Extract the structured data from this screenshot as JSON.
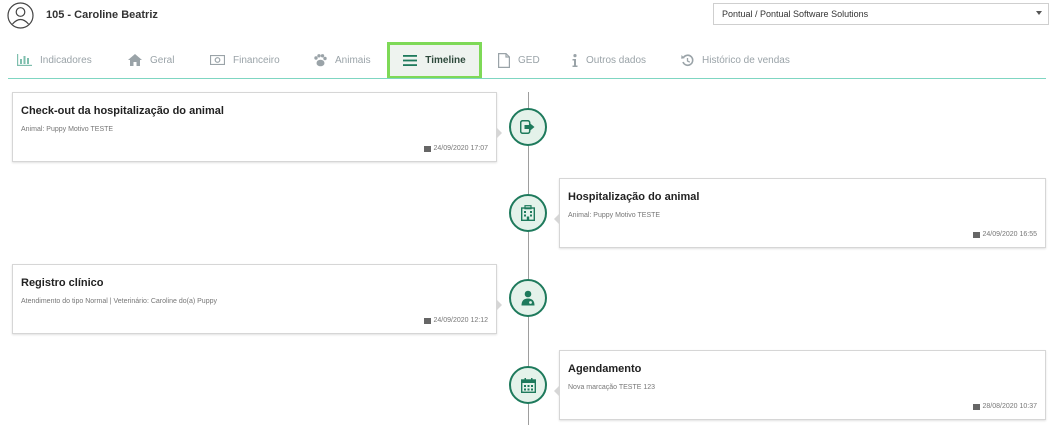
{
  "header": {
    "client_name": "105 - Caroline Beatriz",
    "company_selected": "Pontual / Pontual Software Solutions"
  },
  "tabs": [
    {
      "label": "Indicadores",
      "icon": "bar-chart-icon"
    },
    {
      "label": "Geral",
      "icon": "home-icon"
    },
    {
      "label": "Financeiro",
      "icon": "money-icon"
    },
    {
      "label": "Animais",
      "icon": "paw-icon"
    },
    {
      "label": "Timeline",
      "icon": "list-icon",
      "active": true
    },
    {
      "label": "GED",
      "icon": "document-icon"
    },
    {
      "label": "Outros dados",
      "icon": "info-icon"
    },
    {
      "label": "Histórico de vendas",
      "icon": "history-icon"
    }
  ],
  "timeline": [
    {
      "title": "Check-out da hospitalização do animal",
      "desc": "Animal: Puppy Motivo TESTE",
      "date": "24/09/2020 17:07",
      "icon": "sign-out-icon"
    },
    {
      "title": "Hospitalização do animal",
      "desc": "Animal: Puppy Motivo TESTE",
      "date": "24/09/2020 16:55",
      "icon": "hospital-icon"
    },
    {
      "title": "Registro clínico",
      "desc": "Atendimento do tipo Normal | Veterinário: Caroline do(a) Puppy",
      "date": "24/09/2020 12:12",
      "icon": "doctor-icon"
    },
    {
      "title": "Agendamento",
      "desc": "Nova marcação TESTE 123",
      "date": "28/08/2020 10:37",
      "icon": "calendar-icon"
    }
  ],
  "colors": {
    "accent": "#1e7a5c",
    "active_tab_border": "#7ed957",
    "tab_text": "#9aa3a8",
    "badge_fill": "#e4f2ea"
  }
}
